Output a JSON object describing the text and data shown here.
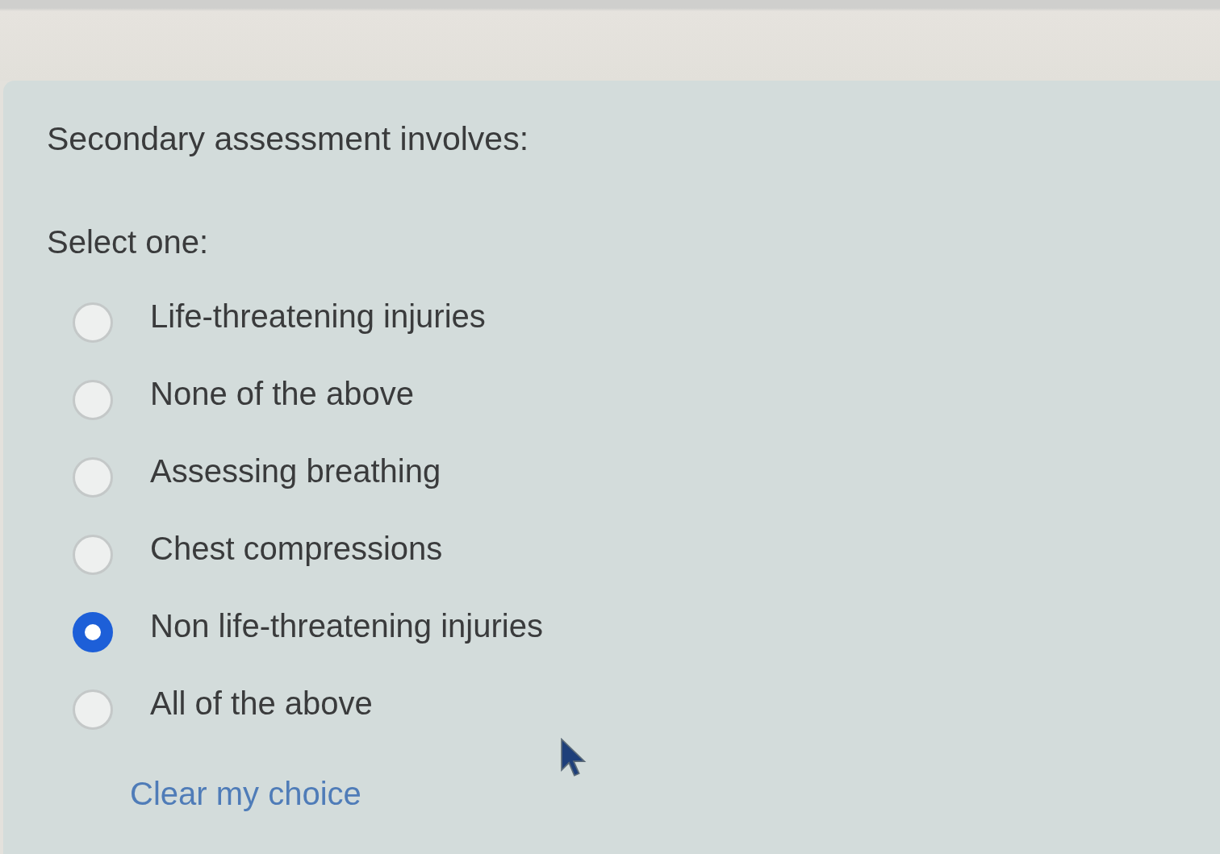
{
  "question": {
    "text": "Secondary assessment involves:"
  },
  "prompt": "Select one:",
  "options": [
    {
      "label": "Life-threatening injuries",
      "selected": false
    },
    {
      "label": "None of the above",
      "selected": false
    },
    {
      "label": "Assessing breathing",
      "selected": false
    },
    {
      "label": "Chest compressions",
      "selected": false
    },
    {
      "label": "Non life-threatening injuries",
      "selected": true
    },
    {
      "label": "All of the above",
      "selected": false
    }
  ],
  "clear_link": "Clear my choice"
}
